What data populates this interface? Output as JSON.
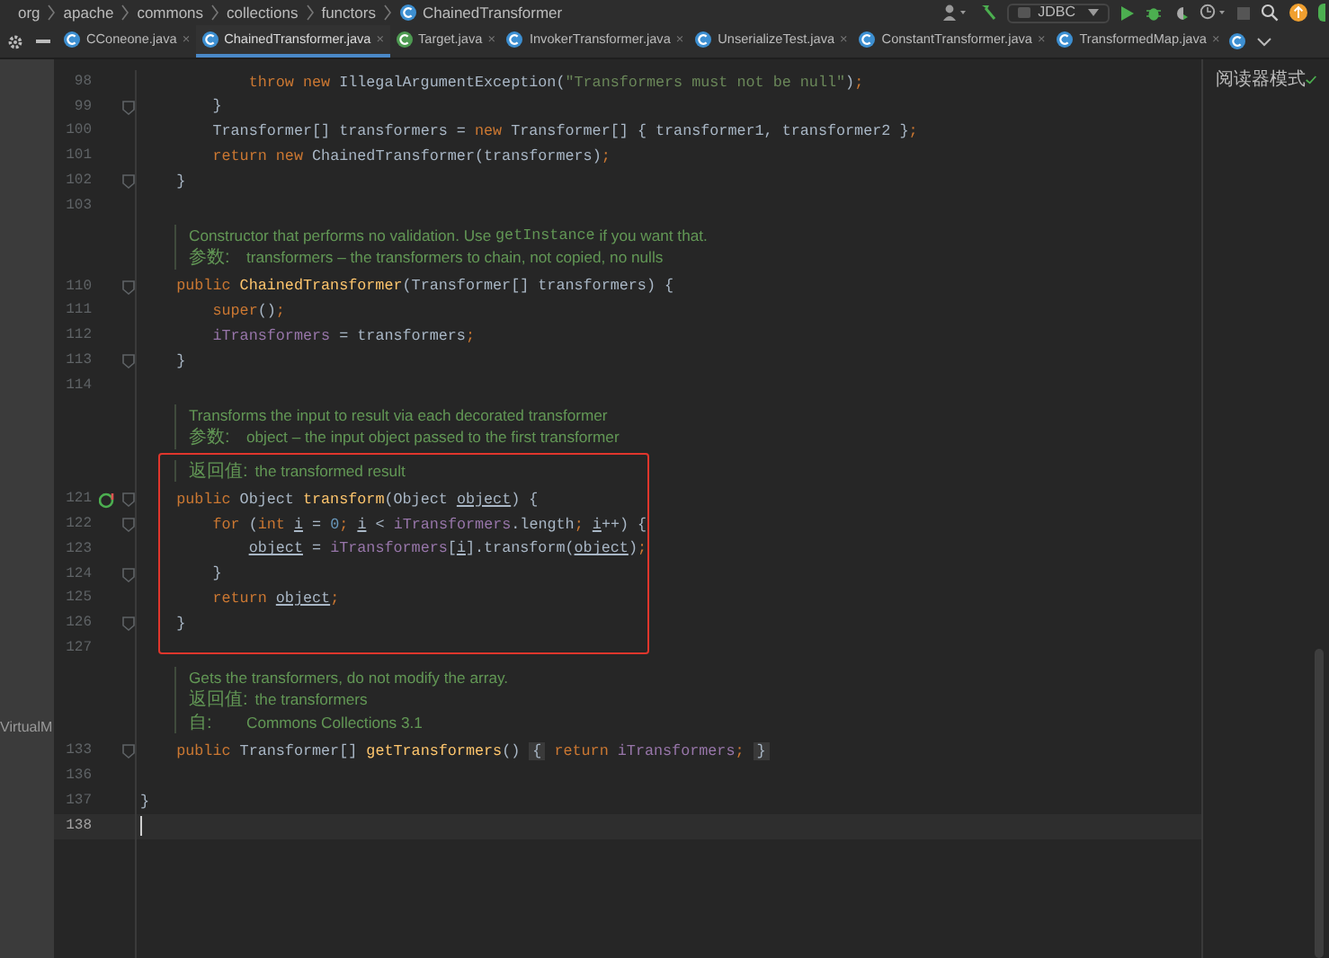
{
  "breadcrumb": [
    "org",
    "apache",
    "commons",
    "collections",
    "functors",
    "ChainedTransformer"
  ],
  "toolbar": {
    "run_config": "JDBC"
  },
  "tabs": [
    {
      "label": "CConeone.java",
      "selected": false,
      "color": "#3d8fd1",
      "close": "×"
    },
    {
      "label": "ChainedTransformer.java",
      "selected": true,
      "color": "#3d8fd1",
      "close": "×"
    },
    {
      "label": "Target.java",
      "selected": false,
      "color": "#4e9a52",
      "close": "×"
    },
    {
      "label": "InvokerTransformer.java",
      "selected": false,
      "color": "#3d8fd1",
      "close": "×"
    },
    {
      "label": "UnserializeTest.java",
      "selected": false,
      "color": "#3d8fd1",
      "close": "×"
    },
    {
      "label": "ConstantTransformer.java",
      "selected": false,
      "color": "#3d8fd1",
      "close": "×"
    },
    {
      "label": "TransformedMap.java",
      "selected": false,
      "color": "#3d8fd1",
      "close": "×"
    }
  ],
  "reader_mode": "阅读器模式",
  "side_panel": {
    "label": "VirtualM"
  },
  "editor": {
    "rows": [
      {
        "kind": "code",
        "number": "98",
        "fold": false,
        "current": false,
        "tokens": [
          {
            "kind": "kw",
            "text": "            throw new "
          },
          {
            "kind": "plain",
            "text": "IllegalArgumentException("
          },
          {
            "kind": "str",
            "text": "\"Transformers must not be null\""
          },
          {
            "kind": "plain",
            "text": ")"
          },
          {
            "kind": "punct",
            "text": ";"
          }
        ]
      },
      {
        "kind": "code",
        "number": "99",
        "fold": true,
        "current": false,
        "tokens": [
          {
            "kind": "plain",
            "text": "        }"
          }
        ]
      },
      {
        "kind": "code",
        "number": "100",
        "fold": false,
        "current": false,
        "tokens": [
          {
            "kind": "plain",
            "text": "        Transformer[] transformers = "
          },
          {
            "kind": "kw",
            "text": "new "
          },
          {
            "kind": "plain",
            "text": "Transformer[] { transformer1, transformer2 }"
          },
          {
            "kind": "punct",
            "text": ";"
          }
        ]
      },
      {
        "kind": "code",
        "number": "101",
        "fold": false,
        "current": false,
        "tokens": [
          {
            "kind": "kw",
            "text": "        return new "
          },
          {
            "kind": "plain",
            "text": "ChainedTransformer(transformers)"
          },
          {
            "kind": "punct",
            "text": ";"
          }
        ]
      },
      {
        "kind": "code",
        "number": "102",
        "fold": true,
        "current": false,
        "tokens": [
          {
            "kind": "plain",
            "text": "    }"
          }
        ]
      },
      {
        "kind": "code",
        "number": "103",
        "fold": false,
        "current": false,
        "tokens": []
      },
      {
        "kind": "doc",
        "lines": [
          {
            "parts": [
              {
                "kind": "text",
                "text": "Constructor that performs no validation. Use "
              },
              {
                "kind": "code",
                "text": "getInstance"
              },
              {
                "kind": "text",
                "text": " if you want that."
              }
            ]
          },
          {
            "label": "参数:",
            "parts": [
              {
                "kind": "text",
                "text": "transformers – the transformers to chain, not copied, no nulls"
              }
            ]
          }
        ]
      },
      {
        "kind": "code",
        "number": "110",
        "fold": true,
        "current": false,
        "tokens": [
          {
            "kind": "kw",
            "text": "    public "
          },
          {
            "kind": "fn",
            "text": "ChainedTransformer"
          },
          {
            "kind": "plain",
            "text": "(Transformer[] transformers) {"
          }
        ]
      },
      {
        "kind": "code",
        "number": "111",
        "fold": false,
        "current": false,
        "tokens": [
          {
            "kind": "kw",
            "text": "        super"
          },
          {
            "kind": "plain",
            "text": "()"
          },
          {
            "kind": "punct",
            "text": ";"
          }
        ]
      },
      {
        "kind": "code",
        "number": "112",
        "fold": false,
        "current": false,
        "tokens": [
          {
            "kind": "field",
            "text": "        iTransformers"
          },
          {
            "kind": "plain",
            "text": " = transformers"
          },
          {
            "kind": "punct",
            "text": ";"
          }
        ]
      },
      {
        "kind": "code",
        "number": "113",
        "fold": true,
        "current": false,
        "tokens": [
          {
            "kind": "plain",
            "text": "    }"
          }
        ]
      },
      {
        "kind": "code",
        "number": "114",
        "fold": false,
        "current": false,
        "tokens": []
      },
      {
        "kind": "doc",
        "lines": [
          {
            "parts": [
              {
                "kind": "text",
                "text": "Transforms the input to result via each decorated transformer"
              }
            ]
          },
          {
            "label": "参数:",
            "parts": [
              {
                "kind": "text",
                "text": "object – the input object passed to the first transformer"
              }
            ]
          }
        ]
      },
      {
        "kind": "box",
        "rows": [
          {
            "kind": "doc",
            "lines": [
              {
                "label": "返回值:",
                "parts": [
                  {
                    "kind": "text",
                    "text": "the transformed result"
                  }
                ]
              }
            ]
          },
          {
            "kind": "code",
            "number": "121",
            "fold": true,
            "current": false,
            "override": true,
            "tokens": [
              {
                "kind": "kw",
                "text": "    public "
              },
              {
                "kind": "plain",
                "text": "Object "
              },
              {
                "kind": "fn",
                "text": "transform"
              },
              {
                "kind": "plain",
                "text": "(Object "
              },
              {
                "kind": "var",
                "text": "object"
              },
              {
                "kind": "plain",
                "text": ") {"
              }
            ]
          },
          {
            "kind": "code",
            "number": "122",
            "fold": true,
            "current": false,
            "tokens": [
              {
                "kind": "kw",
                "text": "        for "
              },
              {
                "kind": "plain",
                "text": "("
              },
              {
                "kind": "kw",
                "text": "int "
              },
              {
                "kind": "var",
                "text": "i"
              },
              {
                "kind": "plain",
                "text": " = "
              },
              {
                "kind": "num",
                "text": "0"
              },
              {
                "kind": "punct",
                "text": "; "
              },
              {
                "kind": "var",
                "text": "i"
              },
              {
                "kind": "plain",
                "text": " < "
              },
              {
                "kind": "field",
                "text": "iTransformers"
              },
              {
                "kind": "plain",
                "text": ".length"
              },
              {
                "kind": "punct",
                "text": "; "
              },
              {
                "kind": "var",
                "text": "i"
              },
              {
                "kind": "plain",
                "text": "++) {"
              }
            ]
          },
          {
            "kind": "code",
            "number": "123",
            "fold": false,
            "current": false,
            "tokens": [
              {
                "kind": "var",
                "text": "            object"
              },
              {
                "kind": "plain",
                "text": " = "
              },
              {
                "kind": "field",
                "text": "iTransformers"
              },
              {
                "kind": "plain",
                "text": "["
              },
              {
                "kind": "var",
                "text": "i"
              },
              {
                "kind": "plain",
                "text": "].transform("
              },
              {
                "kind": "var",
                "text": "object"
              },
              {
                "kind": "plain",
                "text": ")"
              },
              {
                "kind": "punct",
                "text": ";"
              }
            ]
          },
          {
            "kind": "code",
            "number": "124",
            "fold": true,
            "current": false,
            "tokens": [
              {
                "kind": "plain",
                "text": "        }"
              }
            ]
          },
          {
            "kind": "code",
            "number": "125",
            "fold": false,
            "current": false,
            "tokens": [
              {
                "kind": "kw",
                "text": "        return "
              },
              {
                "kind": "var",
                "text": "object"
              },
              {
                "kind": "punct",
                "text": ";"
              }
            ]
          },
          {
            "kind": "code",
            "number": "126",
            "fold": true,
            "current": false,
            "tokens": [
              {
                "kind": "plain",
                "text": "    }"
              }
            ]
          }
        ]
      },
      {
        "kind": "code",
        "number": "127",
        "fold": false,
        "current": false,
        "tokens": []
      },
      {
        "kind": "doc",
        "lines": [
          {
            "parts": [
              {
                "kind": "text",
                "text": "Gets the transformers, do not modify the array."
              }
            ]
          },
          {
            "label": "返回值:",
            "parts": [
              {
                "kind": "text",
                "text": "the transformers"
              }
            ]
          },
          {
            "label": "自:",
            "parts": [
              {
                "kind": "text",
                "text": "Commons Collections 3.1"
              }
            ]
          }
        ]
      },
      {
        "kind": "code",
        "number": "133",
        "fold": true,
        "current": false,
        "tokens": [
          {
            "kind": "kw",
            "text": "    public "
          },
          {
            "kind": "plain",
            "text": "Transformer[] "
          },
          {
            "kind": "fn",
            "text": "getTransformers"
          },
          {
            "kind": "plain",
            "text": "() "
          },
          {
            "kind": "fold",
            "text": "{"
          },
          {
            "kind": "kw",
            "text": " return "
          },
          {
            "kind": "field",
            "text": "iTransformers"
          },
          {
            "kind": "punct",
            "text": "; "
          },
          {
            "kind": "fold",
            "text": "}"
          }
        ]
      },
      {
        "kind": "code",
        "number": "136",
        "fold": false,
        "current": false,
        "tokens": []
      },
      {
        "kind": "code",
        "number": "137",
        "fold": false,
        "current": false,
        "tokens": [
          {
            "kind": "plain",
            "text": "}"
          }
        ]
      },
      {
        "kind": "code",
        "number": "138",
        "fold": false,
        "current": true,
        "tokens": []
      }
    ]
  }
}
